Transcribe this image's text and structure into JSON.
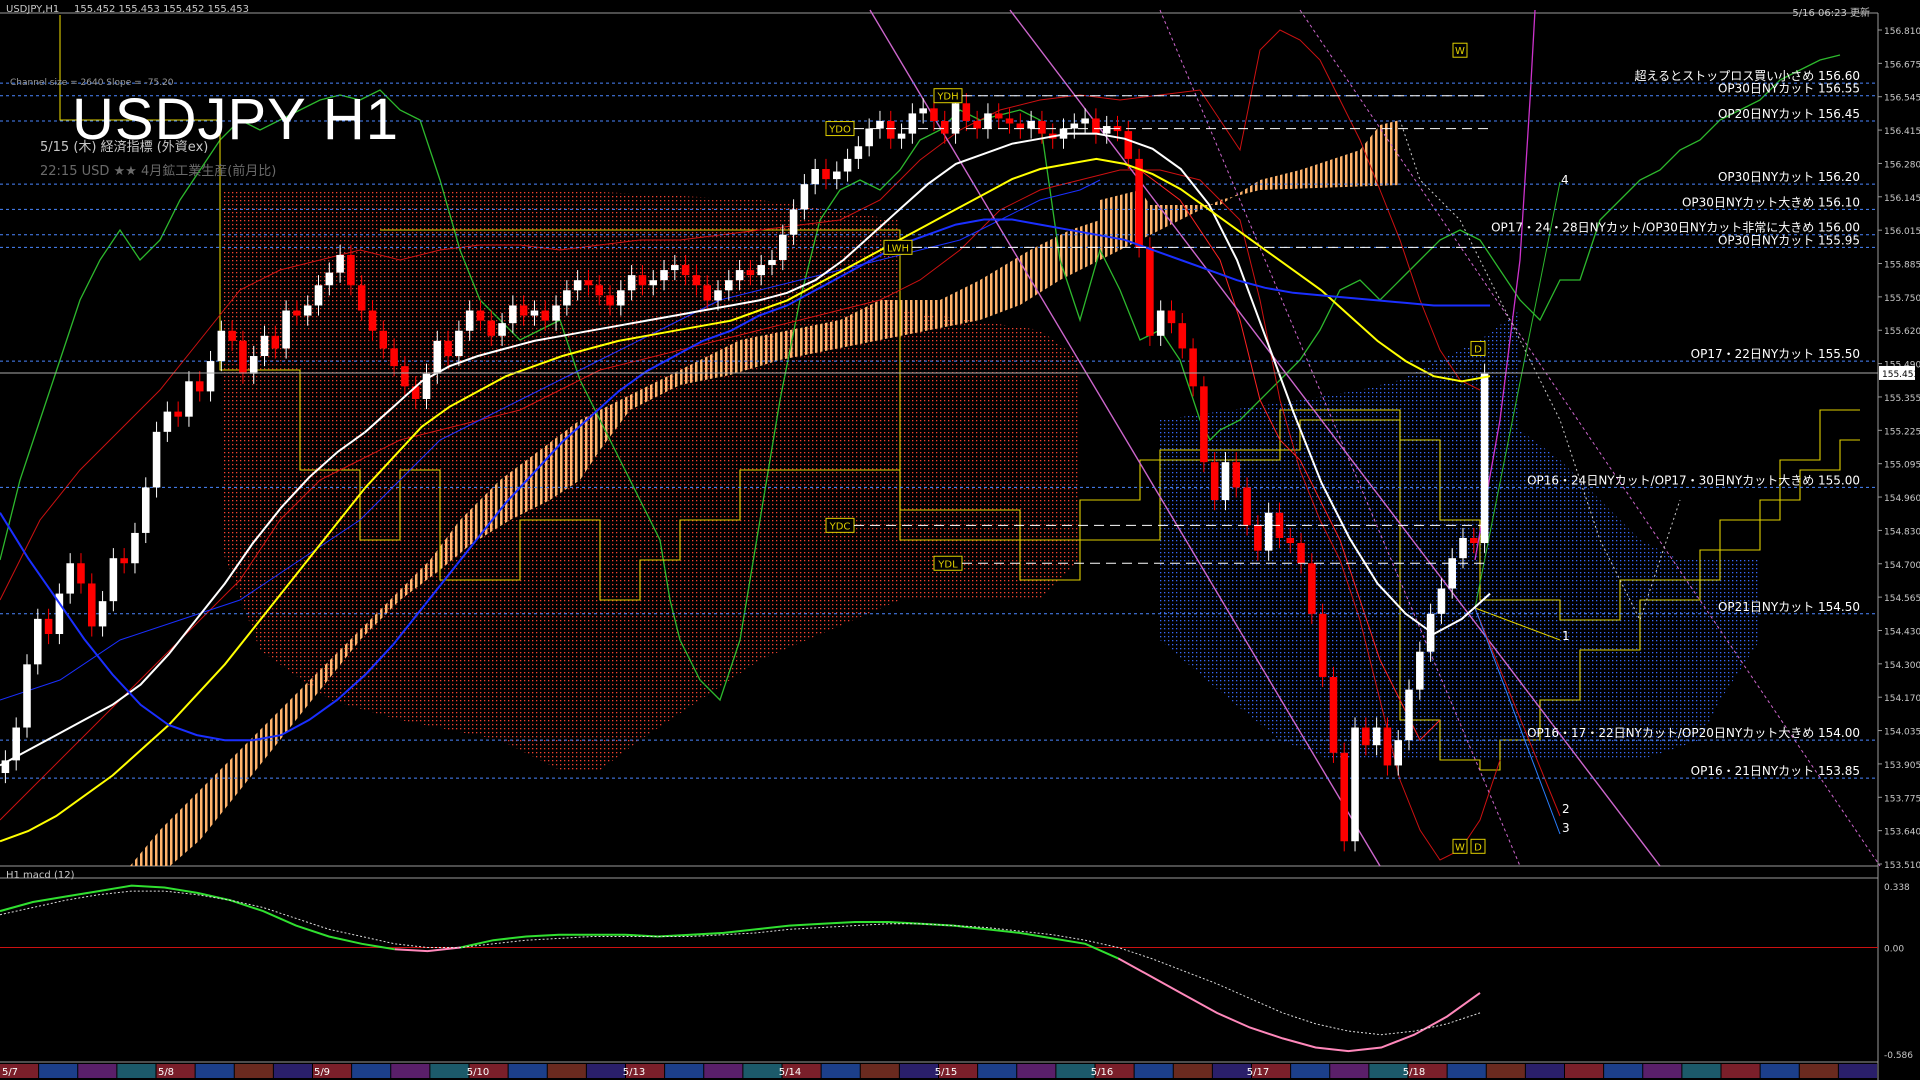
{
  "header": {
    "symbol": "USDJPY,H1",
    "quote": "155.452 155.453 155.452 155.453",
    "updated": "5/16 06:23 更新"
  },
  "overlay": {
    "channel_info": "Channel size = 2640 Slope = -75.20",
    "title": "USDJPY H1",
    "event_date": "5/15 (木) 経済指標 (外資ex)",
    "event_line": "22:15  USD  ★★  4月鉱工業生産(前月比)"
  },
  "macd_label": "H1 macd (12)",
  "colors": {
    "background": "#000000",
    "bull_candle": "#ffffff",
    "bear_candle": "#ff0000",
    "sma_white": "#ffffff",
    "sma_yellow": "#ffff00",
    "sma_blue": "#1a2fff",
    "cloud_bull": "#ffb36b",
    "cloud_bear": "#ff3b2f",
    "future_cloud": "#3a6bff",
    "span_green": "#2db82d",
    "level_line": "#4a86ff",
    "channel": "#cc66cc",
    "macd_main": "#30e030",
    "macd_neg": "#ff88bb"
  },
  "chart_data": [
    {
      "type": "candlestick",
      "symbol": "USDJPY",
      "timeframe": "H1",
      "current_price": 155.453,
      "ylim": [
        153.51,
        156.81
      ],
      "y_ticks": [
        "156.810",
        "156.675",
        "156.545",
        "156.415",
        "156.280",
        "156.145",
        "156.015",
        "155.885",
        "155.750",
        "155.620",
        "155.490",
        "155.355",
        "155.225",
        "155.095",
        "154.960",
        "154.830",
        "154.700",
        "154.565",
        "154.430",
        "154.300",
        "154.170",
        "154.035",
        "153.905",
        "153.775",
        "153.640",
        "153.510"
      ],
      "x_labels": [
        "5/7",
        "5/8",
        "5/9",
        "5/10",
        "5/13",
        "5/14",
        "5/15",
        "5/16",
        "5/17",
        "5/18"
      ],
      "legend": "none",
      "grid": false,
      "closes": [
        153.92,
        154.05,
        154.3,
        154.48,
        154.42,
        154.58,
        154.7,
        154.62,
        154.45,
        154.55,
        154.72,
        154.7,
        154.82,
        155.0,
        155.22,
        155.3,
        155.28,
        155.42,
        155.38,
        155.5,
        155.62,
        155.58,
        155.45,
        155.52,
        155.6,
        155.55,
        155.7,
        155.68,
        155.72,
        155.8,
        155.85,
        155.92,
        155.8,
        155.7,
        155.62,
        155.55,
        155.48,
        155.4,
        155.35,
        155.45,
        155.58,
        155.52,
        155.62,
        155.7,
        155.66,
        155.6,
        155.65,
        155.72,
        155.68,
        155.7,
        155.66,
        155.72,
        155.78,
        155.82,
        155.8,
        155.76,
        155.72,
        155.78,
        155.84,
        155.8,
        155.82,
        155.86,
        155.88,
        155.84,
        155.8,
        155.74,
        155.78,
        155.82,
        155.86,
        155.84,
        155.88,
        155.9,
        156.0,
        156.1,
        156.2,
        156.26,
        156.22,
        156.25,
        156.3,
        156.35,
        156.42,
        156.45,
        156.38,
        156.4,
        156.48,
        156.5,
        156.45,
        156.4,
        156.52,
        156.45,
        156.42,
        156.48,
        156.46,
        156.44,
        156.42,
        156.45,
        156.4,
        156.38,
        156.42,
        156.44,
        156.46,
        156.4,
        156.43,
        156.41,
        156.3,
        155.95,
        155.6,
        155.7,
        155.65,
        155.55,
        155.4,
        155.1,
        154.95,
        155.1,
        155.0,
        154.85,
        154.75,
        154.9,
        154.8,
        154.78,
        154.7,
        154.5,
        154.25,
        153.95,
        153.6,
        154.05,
        153.98,
        154.05,
        153.9,
        154.0,
        154.2,
        154.35,
        154.5,
        154.6,
        154.72,
        154.8,
        154.78,
        155.45
      ],
      "series": [
        {
          "name": "SMA white",
          "values": [
            153.9,
            153.96,
            154.02,
            154.08,
            154.14,
            154.22,
            154.34,
            154.48,
            154.62,
            154.78,
            154.92,
            155.04,
            155.14,
            155.22,
            155.32,
            155.42,
            155.48,
            155.52,
            155.55,
            155.58,
            155.6,
            155.62,
            155.64,
            155.66,
            155.68,
            155.7,
            155.72,
            155.74,
            155.77,
            155.82,
            155.9,
            156.0,
            156.1,
            156.2,
            156.28,
            156.32,
            156.36,
            156.38,
            156.4,
            156.4,
            156.38,
            156.34,
            156.26,
            156.12,
            155.9,
            155.6,
            155.3,
            155.02,
            154.8,
            154.62,
            154.5,
            154.42,
            154.48,
            154.58
          ]
        },
        {
          "name": "SMA yellow",
          "values": [
            153.6,
            153.64,
            153.7,
            153.78,
            153.86,
            153.96,
            154.06,
            154.18,
            154.3,
            154.44,
            154.58,
            154.72,
            154.86,
            155.0,
            155.12,
            155.24,
            155.32,
            155.38,
            155.44,
            155.48,
            155.52,
            155.55,
            155.58,
            155.6,
            155.62,
            155.64,
            155.66,
            155.7,
            155.74,
            155.8,
            155.86,
            155.92,
            155.98,
            156.04,
            156.1,
            156.16,
            156.22,
            156.26,
            156.28,
            156.3,
            156.28,
            156.24,
            156.18,
            156.1,
            156.02,
            155.94,
            155.86,
            155.78,
            155.68,
            155.58,
            155.5,
            155.44,
            155.42,
            155.44
          ]
        },
        {
          "name": "SMA blue",
          "values": [
            154.9,
            154.72,
            154.56,
            154.4,
            154.26,
            154.14,
            154.06,
            154.02,
            154.0,
            154.0,
            154.02,
            154.08,
            154.16,
            154.26,
            154.38,
            154.52,
            154.66,
            154.8,
            154.94,
            155.06,
            155.18,
            155.28,
            155.38,
            155.46,
            155.52,
            155.58,
            155.62,
            155.68,
            155.72,
            155.78,
            155.84,
            155.9,
            155.96,
            156.0,
            156.04,
            156.06,
            156.06,
            156.04,
            156.02,
            156.0,
            155.98,
            155.94,
            155.9,
            155.86,
            155.82,
            155.79,
            155.77,
            155.76,
            155.75,
            155.74,
            155.73,
            155.72,
            155.72,
            155.72
          ]
        }
      ],
      "price_levels": [
        {
          "label": "超えるとストップロス買い小さめ 156.60",
          "price": 156.6
        },
        {
          "label": "OP30日NYカット 156.55",
          "price": 156.55
        },
        {
          "label": "OP20日NYカット 156.45",
          "price": 156.45
        },
        {
          "label": "OP30日NYカット 156.20",
          "price": 156.2
        },
        {
          "label": "OP30日NYカット大きめ 156.10",
          "price": 156.1
        },
        {
          "label": "OP17・24・28日NYカット/OP30日NYカット非常に大きめ 156.00",
          "price": 156.0
        },
        {
          "label": "OP30日NYカット 155.95",
          "price": 155.95
        },
        {
          "label": "OP17・22日NYカット 155.50",
          "price": 155.5
        },
        {
          "label": "OP16・24日NYカット/OP17・30日NYカット大きめ 155.00",
          "price": 155.0
        },
        {
          "label": "OP21日NYカット 154.50",
          "price": 154.5
        },
        {
          "label": "OP16・17・22日NYカット/OP20日NYカット大きめ 154.00",
          "price": 154.0
        },
        {
          "label": "OP16・21日NYカット 153.85",
          "price": 153.85
        }
      ],
      "markers": [
        {
          "label": "YDH",
          "price": 156.55
        },
        {
          "label": "YDO",
          "price": 156.42
        },
        {
          "label": "LWH",
          "price": 155.95
        },
        {
          "label": "YDC",
          "price": 154.85
        },
        {
          "label": "YDL",
          "price": 154.7
        },
        {
          "label": "W",
          "price": 156.73
        },
        {
          "label": "D",
          "price": 155.55
        },
        {
          "label": "W",
          "price": 153.58
        },
        {
          "label": "D",
          "price": 153.58
        }
      ],
      "wave_labels": [
        "4",
        "1",
        "2",
        "3"
      ]
    },
    {
      "type": "line",
      "title": "H1 macd (12)",
      "ylim": [
        -0.586,
        0.338
      ],
      "y_ticks": [
        "0.338",
        "0.00",
        "-0.586"
      ],
      "main": [
        0.2,
        0.25,
        0.28,
        0.31,
        0.34,
        0.33,
        0.3,
        0.26,
        0.2,
        0.12,
        0.06,
        0.02,
        -0.01,
        -0.02,
        0.0,
        0.04,
        0.06,
        0.07,
        0.07,
        0.07,
        0.06,
        0.07,
        0.08,
        0.1,
        0.12,
        0.13,
        0.14,
        0.14,
        0.13,
        0.12,
        0.1,
        0.08,
        0.05,
        0.02,
        -0.06,
        -0.16,
        -0.26,
        -0.36,
        -0.44,
        -0.5,
        -0.55,
        -0.57,
        -0.55,
        -0.48,
        -0.38,
        -0.25
      ],
      "signal": [
        0.18,
        0.22,
        0.26,
        0.29,
        0.31,
        0.31,
        0.29,
        0.26,
        0.22,
        0.16,
        0.1,
        0.06,
        0.02,
        0.0,
        0.0,
        0.02,
        0.04,
        0.05,
        0.06,
        0.06,
        0.06,
        0.06,
        0.07,
        0.08,
        0.1,
        0.11,
        0.12,
        0.13,
        0.13,
        0.12,
        0.11,
        0.09,
        0.07,
        0.04,
        0.0,
        -0.06,
        -0.13,
        -0.2,
        -0.28,
        -0.36,
        -0.42,
        -0.46,
        -0.48,
        -0.46,
        -0.42,
        -0.36
      ]
    }
  ]
}
